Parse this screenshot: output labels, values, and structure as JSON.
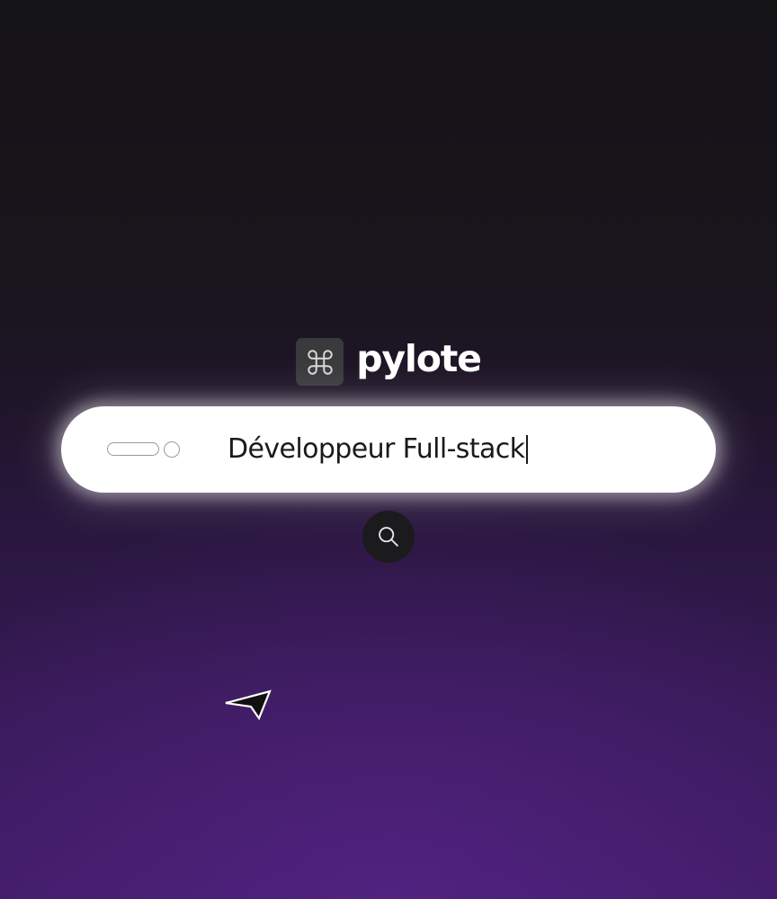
{
  "brand": {
    "logo_icon": "command-key-icon",
    "name": "pylote"
  },
  "search": {
    "value": "Développeur Full-stack",
    "toggle_icon": "toggle-switch-icon",
    "button_icon": "search-icon"
  },
  "cursor": {
    "icon": "send-arrow-icon"
  },
  "colors": {
    "background_top": "#151417",
    "background_bottom": "#3f1d66",
    "bar": "#ffffff",
    "text": "#1a1a1a",
    "button": "#1b1b1d",
    "logo_badge": "#3a3a3c"
  }
}
